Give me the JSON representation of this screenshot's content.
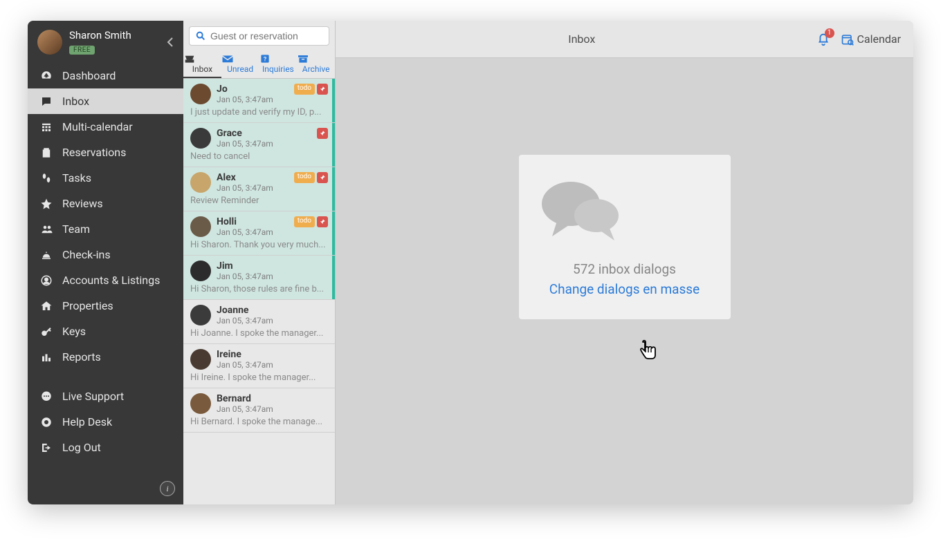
{
  "user": {
    "name": "Sharon Smith",
    "plan_badge": "FREE"
  },
  "sidebar": {
    "items": [
      {
        "key": "dashboard",
        "label": "Dashboard"
      },
      {
        "key": "inbox",
        "label": "Inbox",
        "active": true
      },
      {
        "key": "multi-calendar",
        "label": "Multi-calendar"
      },
      {
        "key": "reservations",
        "label": "Reservations"
      },
      {
        "key": "tasks",
        "label": "Tasks"
      },
      {
        "key": "reviews",
        "label": "Reviews"
      },
      {
        "key": "team",
        "label": "Team"
      },
      {
        "key": "check-ins",
        "label": "Check-ins"
      },
      {
        "key": "accounts-listings",
        "label": "Accounts & Listings"
      },
      {
        "key": "properties",
        "label": "Properties"
      },
      {
        "key": "keys",
        "label": "Keys"
      },
      {
        "key": "reports",
        "label": "Reports"
      }
    ],
    "bottom": [
      {
        "key": "live-support",
        "label": "Live Support"
      },
      {
        "key": "help-desk",
        "label": "Help Desk"
      },
      {
        "key": "log-out",
        "label": "Log Out"
      }
    ]
  },
  "list": {
    "search_placeholder": "Guest or reservation",
    "tabs": [
      {
        "key": "inbox",
        "label": "Inbox",
        "active": true
      },
      {
        "key": "unread",
        "label": "Unread"
      },
      {
        "key": "inquiries",
        "label": "Inquiries"
      },
      {
        "key": "archive",
        "label": "Archive"
      }
    ],
    "threads": [
      {
        "name": "Jo",
        "time": "Jan 05, 3:47am",
        "preview": "I just update and verify my ID, p...",
        "todo": true,
        "pin": true,
        "unread": true
      },
      {
        "name": "Grace",
        "time": "Jan 05, 3:47am",
        "preview": "Need to cancel",
        "todo": false,
        "pin": true,
        "unread": true
      },
      {
        "name": "Alex",
        "time": "Jan 05, 3:47am",
        "preview": "Review Reminder",
        "todo": true,
        "pin": true,
        "unread": true
      },
      {
        "name": "Holli",
        "time": "Jan 05, 3:47am",
        "preview": "Hi Sharon. Thank you very much...",
        "todo": true,
        "pin": true,
        "unread": true
      },
      {
        "name": "Jim",
        "time": "Jan 05, 3:47am",
        "preview": "Hi Sharon, those rules are fine b...",
        "todo": false,
        "pin": false,
        "unread": true
      },
      {
        "name": "Joanne",
        "time": "Jan 05, 3:47am",
        "preview": "Hi Joanne. I spoke the manager...",
        "todo": false,
        "pin": false,
        "unread": false
      },
      {
        "name": "Ireine",
        "time": "Jan 05, 3:47am",
        "preview": "Hi Ireine. I spoke the manager...",
        "todo": false,
        "pin": false,
        "unread": false
      },
      {
        "name": "Bernard",
        "time": "Jan 05, 3:47am",
        "preview": "Hi Bernard. I spoke the manage...",
        "todo": false,
        "pin": false,
        "unread": false
      }
    ],
    "badge_todo_label": "todo"
  },
  "topbar": {
    "title": "Inbox",
    "notification_count": "1",
    "calendar_label": "Calendar"
  },
  "empty": {
    "count_text": "572 inbox dialogs",
    "link_text": "Change dialogs en masse"
  }
}
